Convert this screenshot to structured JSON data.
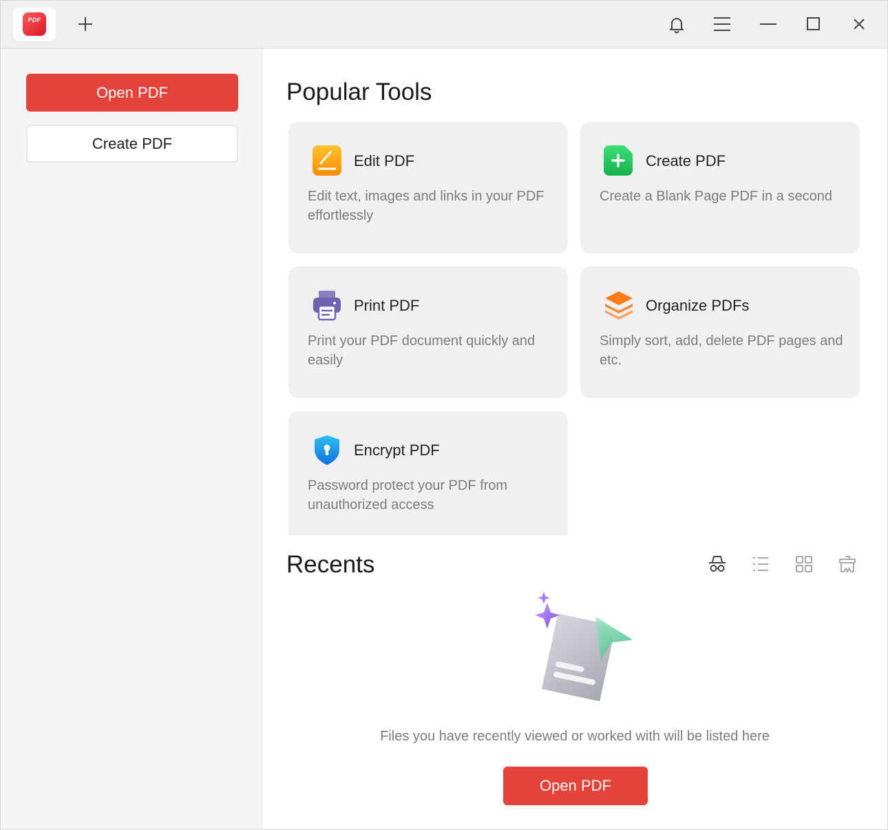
{
  "titlebar": {
    "logo_text": "PDF",
    "icons": {
      "new_tab": "plus-icon",
      "notifications": "bell-icon",
      "menu": "hamburger-menu-icon",
      "minimize": "minimize-icon",
      "maximize": "maximize-icon",
      "close": "close-icon"
    }
  },
  "sidebar": {
    "open_label": "Open PDF",
    "create_label": "Create PDF"
  },
  "popular": {
    "title": "Popular Tools",
    "tools": [
      {
        "title": "Edit PDF",
        "desc": "Edit text, images and links in your PDF effortlessly",
        "icon": "edit-pdf-icon"
      },
      {
        "title": "Create PDF",
        "desc": "Create a Blank Page PDF in a second",
        "icon": "create-pdf-icon"
      },
      {
        "title": "Print PDF",
        "desc": "Print your PDF document quickly and easily",
        "icon": "printer-icon"
      },
      {
        "title": "Organize PDFs",
        "desc": "Simply sort, add, delete PDF pages and etc.",
        "icon": "layers-icon"
      },
      {
        "title": "Encrypt PDF",
        "desc": "Password protect your PDF from unauthorized access",
        "icon": "shield-lock-icon"
      }
    ]
  },
  "recents": {
    "title": "Recents",
    "view_icons": [
      "incognito-icon",
      "list-view-icon",
      "grid-view-icon",
      "clear-recents-icon"
    ],
    "empty_text": "Files you have recently viewed or worked with will be listed here",
    "open_label": "Open PDF"
  },
  "colors": {
    "accent": "#e5423a",
    "sidebar_bg": "#f5f5f5",
    "card_bg": "#f0f0f0",
    "muted_text": "#7c7c7c"
  }
}
